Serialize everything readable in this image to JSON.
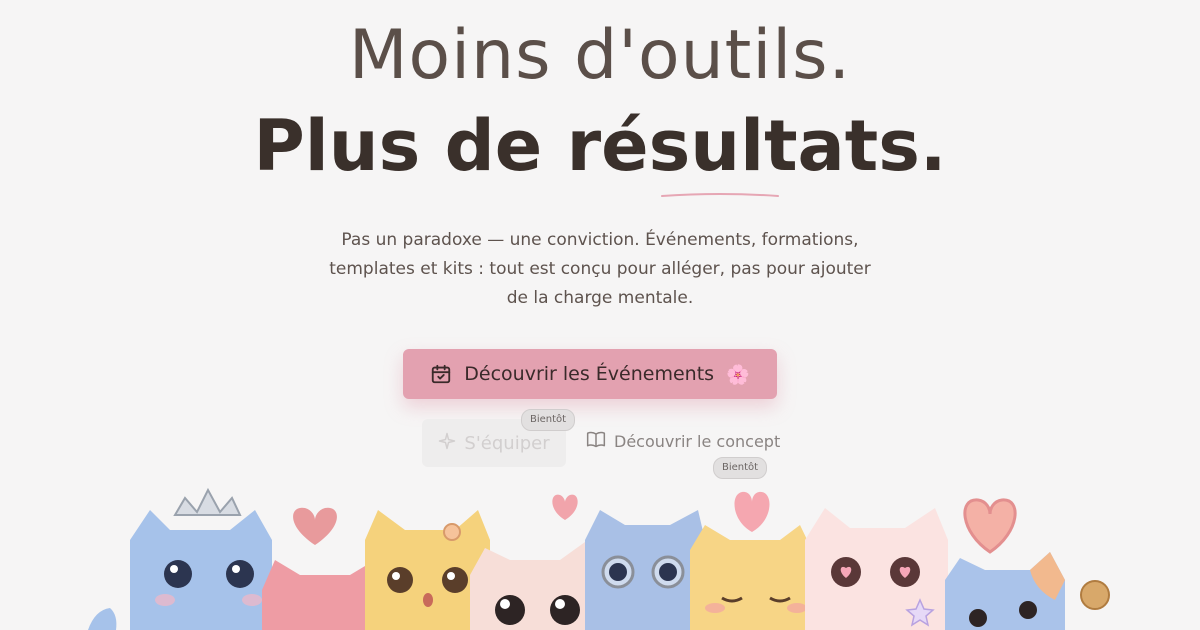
{
  "hero": {
    "headline_line1": "Moins d'outils.",
    "headline_line2": "Plus de résultats.",
    "subtitle_line1": "Pas un paradoxe — une conviction. Événements, formations,",
    "subtitle_line2": "templates et kits : tout est conçu pour alléger, pas pour ajouter",
    "subtitle_line3": "de la charge mentale."
  },
  "actions": {
    "primary_label": "Découvrir les Événements",
    "primary_emoji": "🌸",
    "primary_icon": "calendar-check-icon",
    "secondary_label": "S'équiper",
    "secondary_icon": "sparkle-icon",
    "secondary_badge": "Bientôt",
    "concept_label": "Découvrir le concept",
    "concept_icon": "book-open-icon",
    "concept_badge": "Bientôt"
  },
  "colors": {
    "accent": "#e3a1b0",
    "background": "#f6f5f5",
    "heading": "#3a302b"
  }
}
